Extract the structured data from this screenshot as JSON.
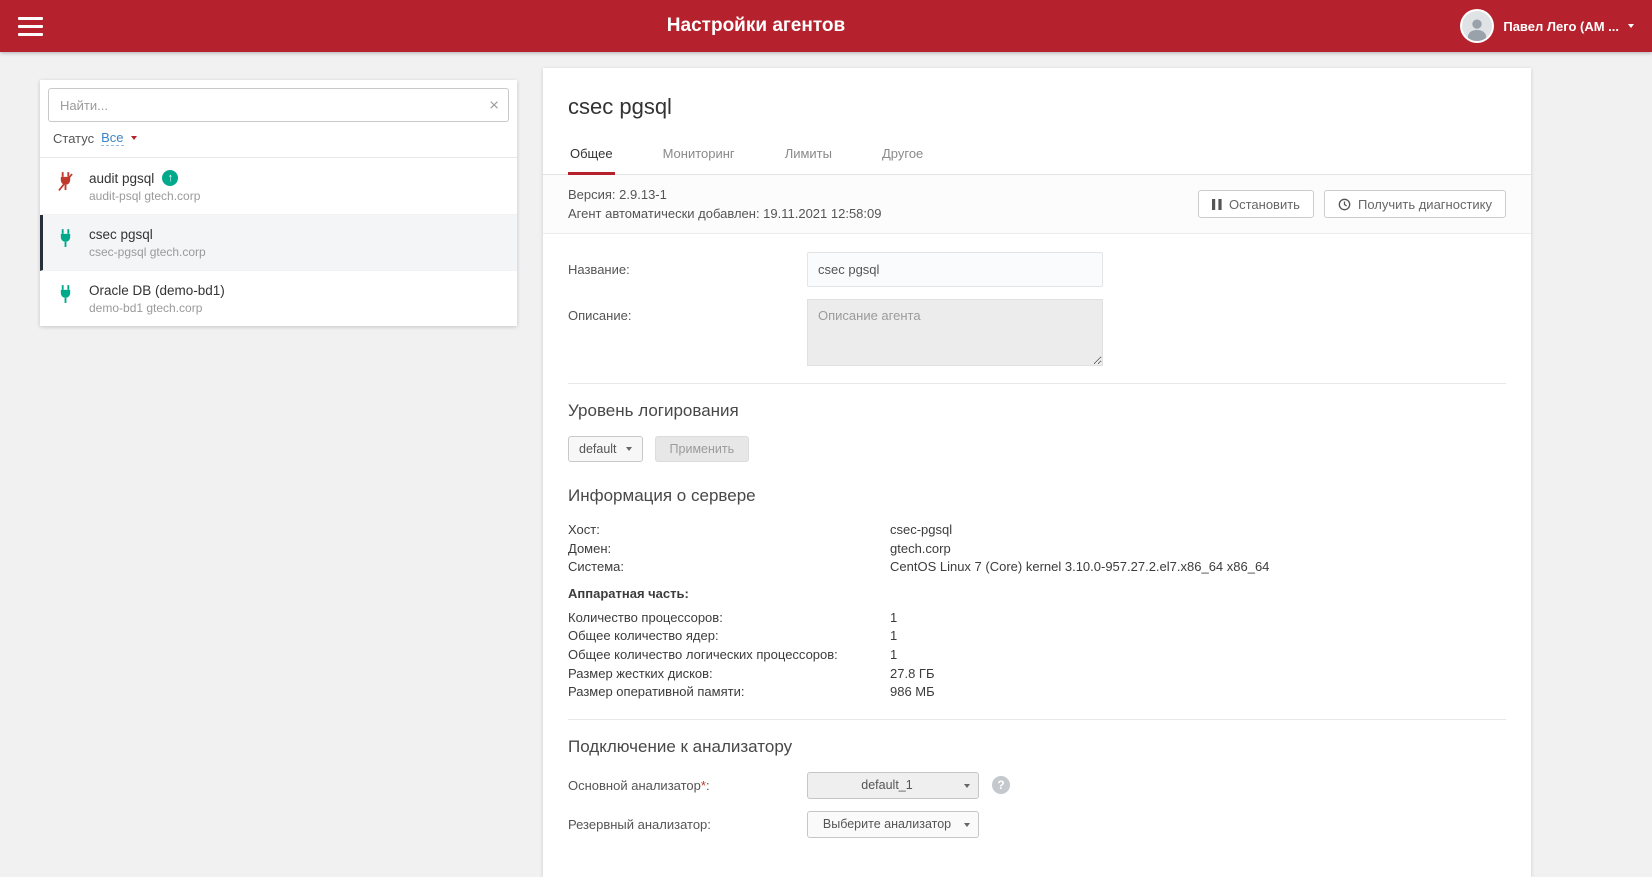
{
  "header": {
    "title": "Настройки агентов",
    "user_name": "Павел Лего (АМ ..."
  },
  "icons": {
    "clear": "×",
    "help": "?",
    "update_arrow": "↑"
  },
  "sidebar": {
    "search_placeholder": "Найти...",
    "status_label": "Статус",
    "status_value": "Все",
    "agents": [
      {
        "name": "audit pgsql",
        "subtitle": "audit-psql gtech.corp",
        "status": "disconnected",
        "has_update": true,
        "selected": false
      },
      {
        "name": "csec pgsql",
        "subtitle": "csec-pgsql gtech.corp",
        "status": "connected",
        "has_update": false,
        "selected": true
      },
      {
        "name": "Oracle DB (demo-bd1)",
        "subtitle": "demo-bd1 gtech.corp",
        "status": "connected",
        "has_update": false,
        "selected": false
      }
    ]
  },
  "main": {
    "title": "csec pgsql",
    "tabs": [
      {
        "label": "Общее",
        "active": true
      },
      {
        "label": "Мониторинг",
        "active": false
      },
      {
        "label": "Лимиты",
        "active": false
      },
      {
        "label": "Другое",
        "active": false
      }
    ],
    "meta": {
      "version_line": "Версия: 2.9.13-1",
      "added_line": "Агент автоматически добавлен: 19.11.2021 12:58:09",
      "stop_button": "Остановить",
      "diagnostics_button": "Получить диагностику"
    },
    "form": {
      "name_label": "Название:",
      "name_value": "csec pgsql",
      "description_label": "Описание:",
      "description_placeholder": "Описание агента"
    },
    "logging": {
      "title": "Уровень логирования",
      "level_value": "default",
      "apply_button": "Применить"
    },
    "server_info": {
      "title": "Информация о сервере",
      "rows": [
        {
          "label": "Хост:",
          "value": "csec-pgsql"
        },
        {
          "label": "Домен:",
          "value": "gtech.corp"
        },
        {
          "label": "Система:",
          "value": "CentOS Linux 7 (Core) kernel 3.10.0-957.27.2.el7.x86_64 x86_64"
        }
      ],
      "hardware_title": "Аппаратная часть:",
      "hardware_rows": [
        {
          "label": "Количество процессоров:",
          "value": "1"
        },
        {
          "label": "Общее количество ядер:",
          "value": "1"
        },
        {
          "label": "Общее количество логических процессоров:",
          "value": "1"
        },
        {
          "label": "Размер жестких дисков:",
          "value": "27.8 ГБ"
        },
        {
          "label": "Размер оперативной памяти:",
          "value": "986 МБ"
        }
      ]
    },
    "analyzer": {
      "title": "Подключение к анализатору",
      "primary_label": "Основной анализатор",
      "required_mark": "*",
      "colon": ":",
      "primary_value": "default_1",
      "backup_label": "Резервный анализатор:",
      "backup_placeholder": "Выберите анализатор"
    }
  }
}
